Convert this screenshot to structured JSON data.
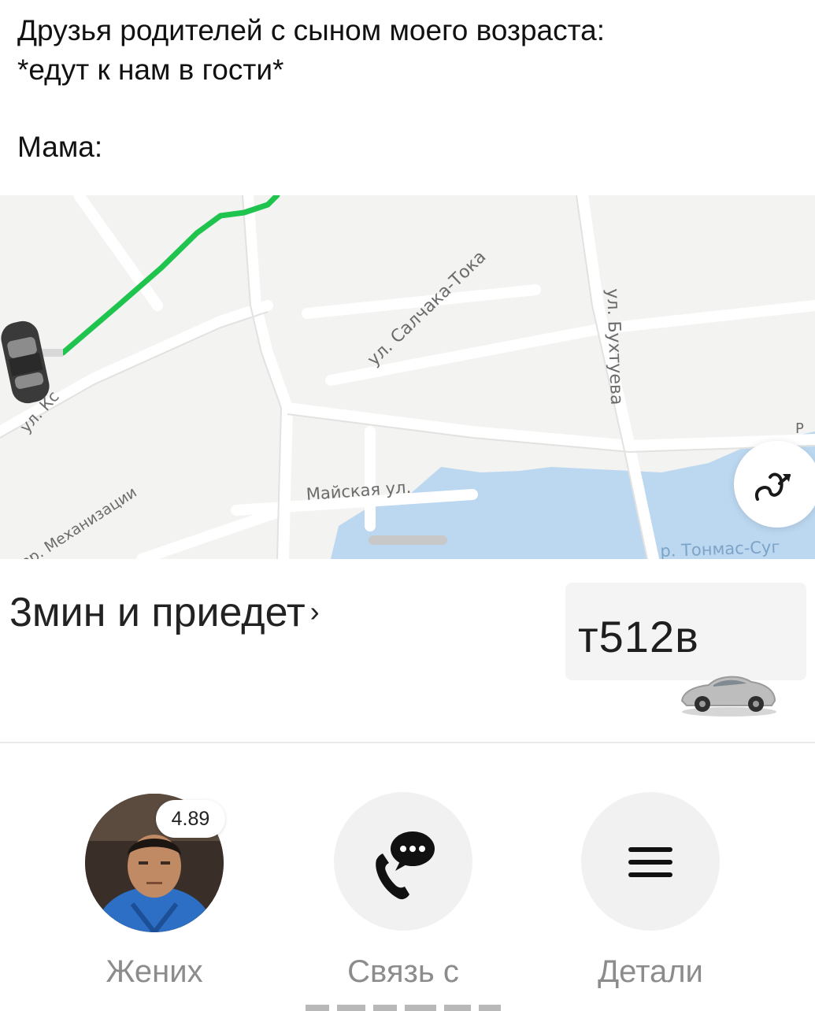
{
  "caption": {
    "line1": "Друзья родителей с сыном моего возраста:",
    "line2": "*едут к нам в гости*",
    "line3": "Мама:"
  },
  "map": {
    "streets": {
      "salchak": "ул. Салчака-Тока",
      "bukhtueva": "ул. Бухтуева",
      "mekhanizatsii": "пер. Механизации",
      "maiskaya": "Майская ул.",
      "tonmas": "р. Тонмас-Суг",
      "partial_left": "ул. Кс",
      "partial_right": "Р"
    },
    "route_color": "#1fc44e",
    "water_color": "#bcd8f1",
    "route_button_icon": "route-icon"
  },
  "trip": {
    "eta_text": "3мин и приедет",
    "eta_chevron": "›",
    "plate": "т512в",
    "car_icon": "car-icon"
  },
  "actions": [
    {
      "label": "Жених",
      "icon": "driver-avatar",
      "rating": "4.89"
    },
    {
      "label": "Связь с",
      "icon": "phone-chat-icon"
    },
    {
      "label": "Детали",
      "icon": "menu-icon"
    }
  ]
}
